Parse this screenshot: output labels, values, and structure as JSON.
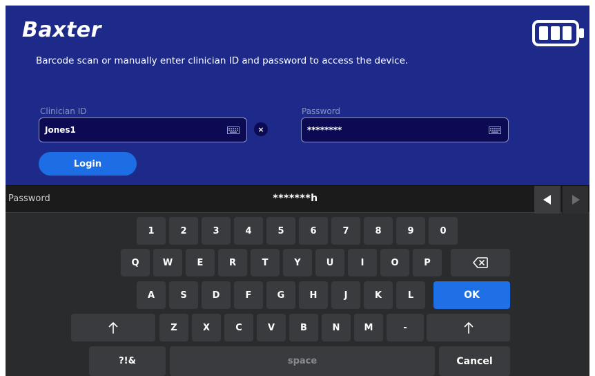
{
  "header": {
    "logo_text": "Baxter",
    "battery_icon": "battery-full-icon",
    "instructions": "Barcode scan or manually enter clinician ID and password to access the device."
  },
  "form": {
    "clinician_id_label": "Clinician ID",
    "clinician_id_value": "Jones1",
    "clear_symbol": "×",
    "password_label": "Password",
    "password_value": "********",
    "login_label": "Login"
  },
  "keyboard": {
    "input_label": "Password",
    "input_value": "*******h",
    "row1": [
      "1",
      "2",
      "3",
      "4",
      "5",
      "6",
      "7",
      "8",
      "9",
      "0"
    ],
    "row2": [
      "Q",
      "W",
      "E",
      "R",
      "T",
      "Y",
      "U",
      "I",
      "O",
      "P"
    ],
    "row3": [
      "A",
      "S",
      "D",
      "F",
      "G",
      "H",
      "J",
      "K",
      "L"
    ],
    "row4": [
      "Z",
      "X",
      "C",
      "V",
      "B",
      "N",
      "M",
      "-"
    ],
    "ok_label": "OK",
    "symbols_label": "?!&",
    "space_label": "space",
    "cancel_label": "Cancel"
  },
  "colors": {
    "panel_background": "#1e2a8a",
    "field_background": "#0c0a52",
    "accent_blue": "#1f6fe6",
    "keyboard_background": "#2a2b2d",
    "key_background": "#3a3b3e"
  }
}
